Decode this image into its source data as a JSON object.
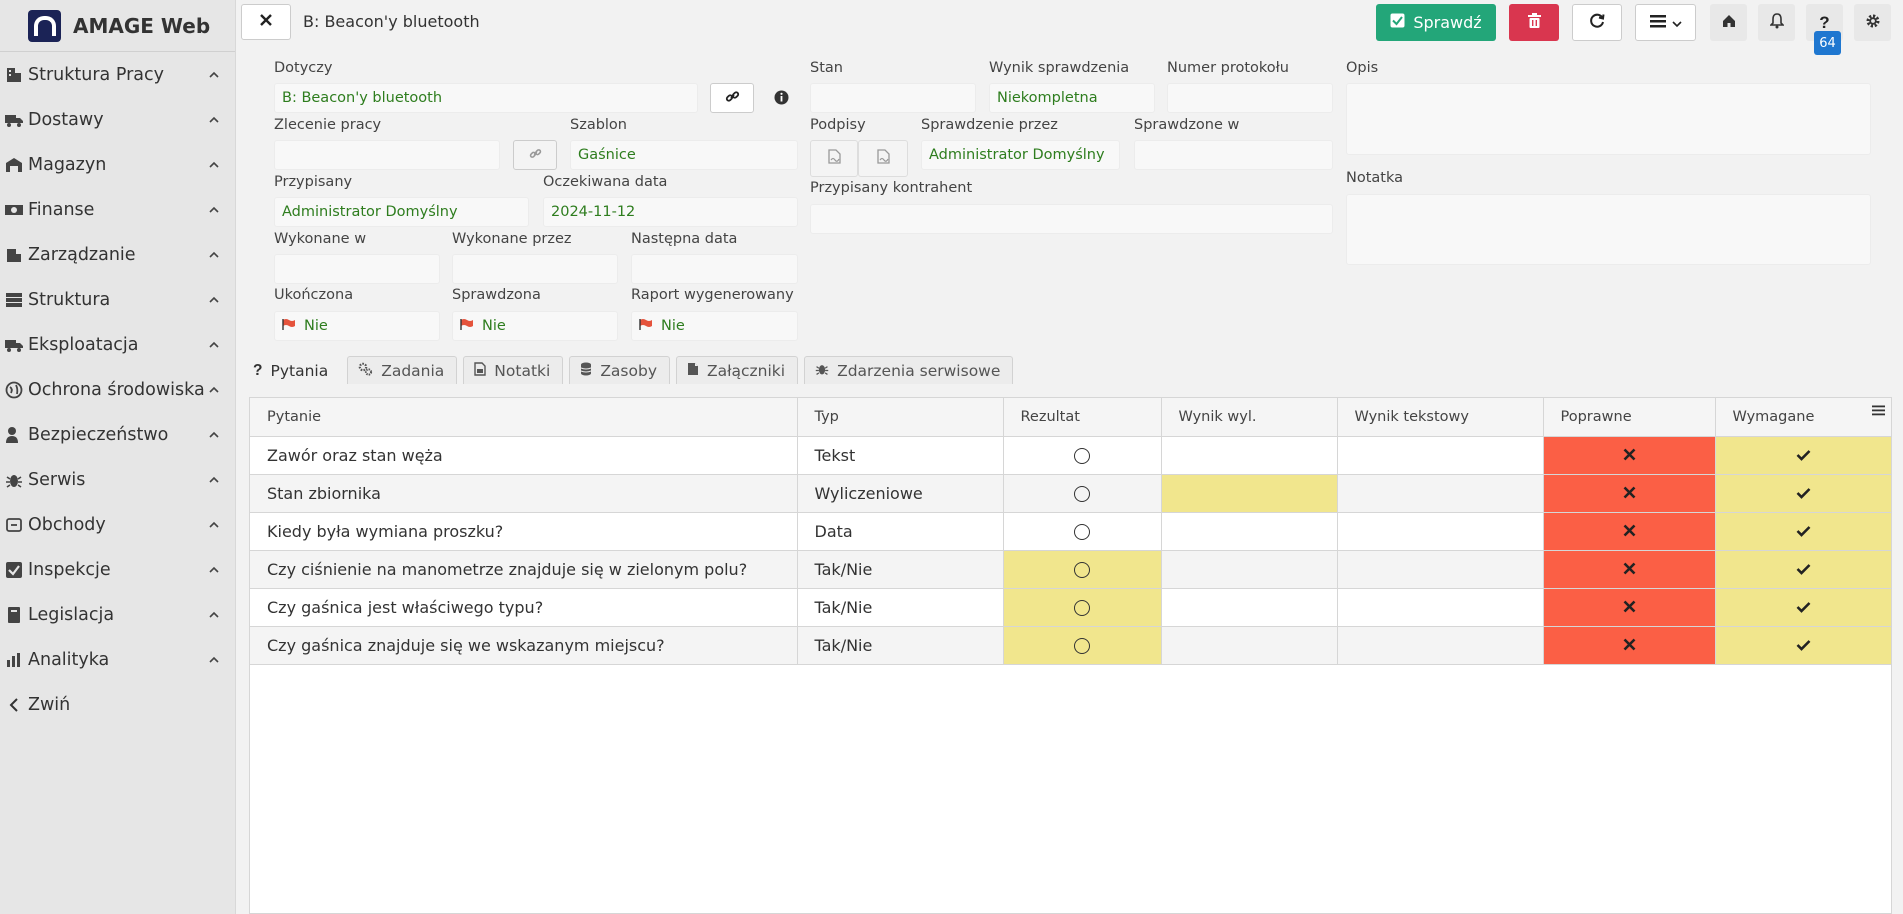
{
  "app": {
    "name": "AMAGE Web"
  },
  "sidebar": {
    "items": [
      {
        "label": "Struktura Pracy",
        "icon": "building-icon"
      },
      {
        "label": "Dostawy",
        "icon": "truck-icon"
      },
      {
        "label": "Magazyn",
        "icon": "warehouse-icon"
      },
      {
        "label": "Finanse",
        "icon": "money-icon"
      },
      {
        "label": "Zarządzanie",
        "icon": "management-icon"
      },
      {
        "label": "Struktura",
        "icon": "structure-icon"
      },
      {
        "label": "Eksploatacja",
        "icon": "truck-icon"
      },
      {
        "label": "Ochrona środowiska",
        "icon": "globe-icon"
      },
      {
        "label": "Bezpieczeństwo",
        "icon": "user-shield-icon"
      },
      {
        "label": "Serwis",
        "icon": "bug-icon"
      },
      {
        "label": "Obchody",
        "icon": "route-icon"
      },
      {
        "label": "Inspekcje",
        "icon": "checkbox-icon"
      },
      {
        "label": "Legislacja",
        "icon": "book-icon"
      },
      {
        "label": "Analityka",
        "icon": "chart-icon"
      }
    ],
    "collapse_label": "Zwiń"
  },
  "header": {
    "title": "B: Beacon'y bluetooth",
    "check_button": "Sprawdź",
    "notification_count": "64"
  },
  "form": {
    "dotyczy": {
      "label": "Dotyczy",
      "value": "B: Beacon'y bluetooth"
    },
    "zlecenie": {
      "label": "Zlecenie pracy",
      "value": ""
    },
    "szablon": {
      "label": "Szablon",
      "value": "Gaśnice"
    },
    "przypisany": {
      "label": "Przypisany",
      "value": "Administrator Domyślny"
    },
    "oczekiwana": {
      "label": "Oczekiwana data",
      "value": "2024-11-12"
    },
    "wykonane_w": {
      "label": "Wykonane w",
      "value": ""
    },
    "wykonane_przez": {
      "label": "Wykonane przez",
      "value": ""
    },
    "nastepna": {
      "label": "Następna data",
      "value": ""
    },
    "ukonczona": {
      "label": "Ukończona",
      "value": "Nie"
    },
    "sprawdzona": {
      "label": "Sprawdzona",
      "value": "Nie"
    },
    "raport": {
      "label": "Raport wygenerowany",
      "value": "Nie"
    },
    "stan": {
      "label": "Stan",
      "value": ""
    },
    "wynik": {
      "label": "Wynik sprawdzenia",
      "value": "Niekompletna"
    },
    "numer": {
      "label": "Numer protokołu",
      "value": ""
    },
    "podpisy": {
      "label": "Podpisy"
    },
    "sprawdzenie_przez": {
      "label": "Sprawdzenie przez",
      "value": "Administrator Domyślny"
    },
    "sprawdzone_w": {
      "label": "Sprawdzone w",
      "value": ""
    },
    "kontrahent": {
      "label": "Przypisany kontrahent",
      "value": ""
    },
    "opis": {
      "label": "Opis",
      "value": ""
    },
    "notatka": {
      "label": "Notatka",
      "value": ""
    }
  },
  "tabs": [
    {
      "label": "Pytania",
      "active": true
    },
    {
      "label": "Zadania"
    },
    {
      "label": "Notatki"
    },
    {
      "label": "Zasoby"
    },
    {
      "label": "Załączniki"
    },
    {
      "label": "Zdarzenia serwisowe"
    }
  ],
  "table": {
    "columns": [
      "Pytanie",
      "Typ",
      "Rezultat",
      "Wynik wyl.",
      "Wynik tekstowy",
      "Poprawne",
      "Wymagane"
    ],
    "rows": [
      {
        "pytanie": "Zawór oraz stan węża",
        "typ": "Tekst"
      },
      {
        "pytanie": "Stan zbiornika",
        "typ": "Wyliczeniowe"
      },
      {
        "pytanie": "Kiedy była wymiana proszku?",
        "typ": "Data"
      },
      {
        "pytanie": "Czy ciśnienie na manometrze znajduje się w zielonym polu?",
        "typ": "Tak/Nie"
      },
      {
        "pytanie": "Czy gaśnica jest właściwego typu?",
        "typ": "Tak/Nie"
      },
      {
        "pytanie": "Czy gaśnica znajduje się we wskazanym miejscu?",
        "typ": "Tak/Nie"
      }
    ]
  },
  "colors": {
    "success": "#23a679",
    "danger": "#d9364f",
    "highlight": "#f1e68d",
    "wrong": "#fb5f45",
    "value_text": "#2e7d1e"
  }
}
